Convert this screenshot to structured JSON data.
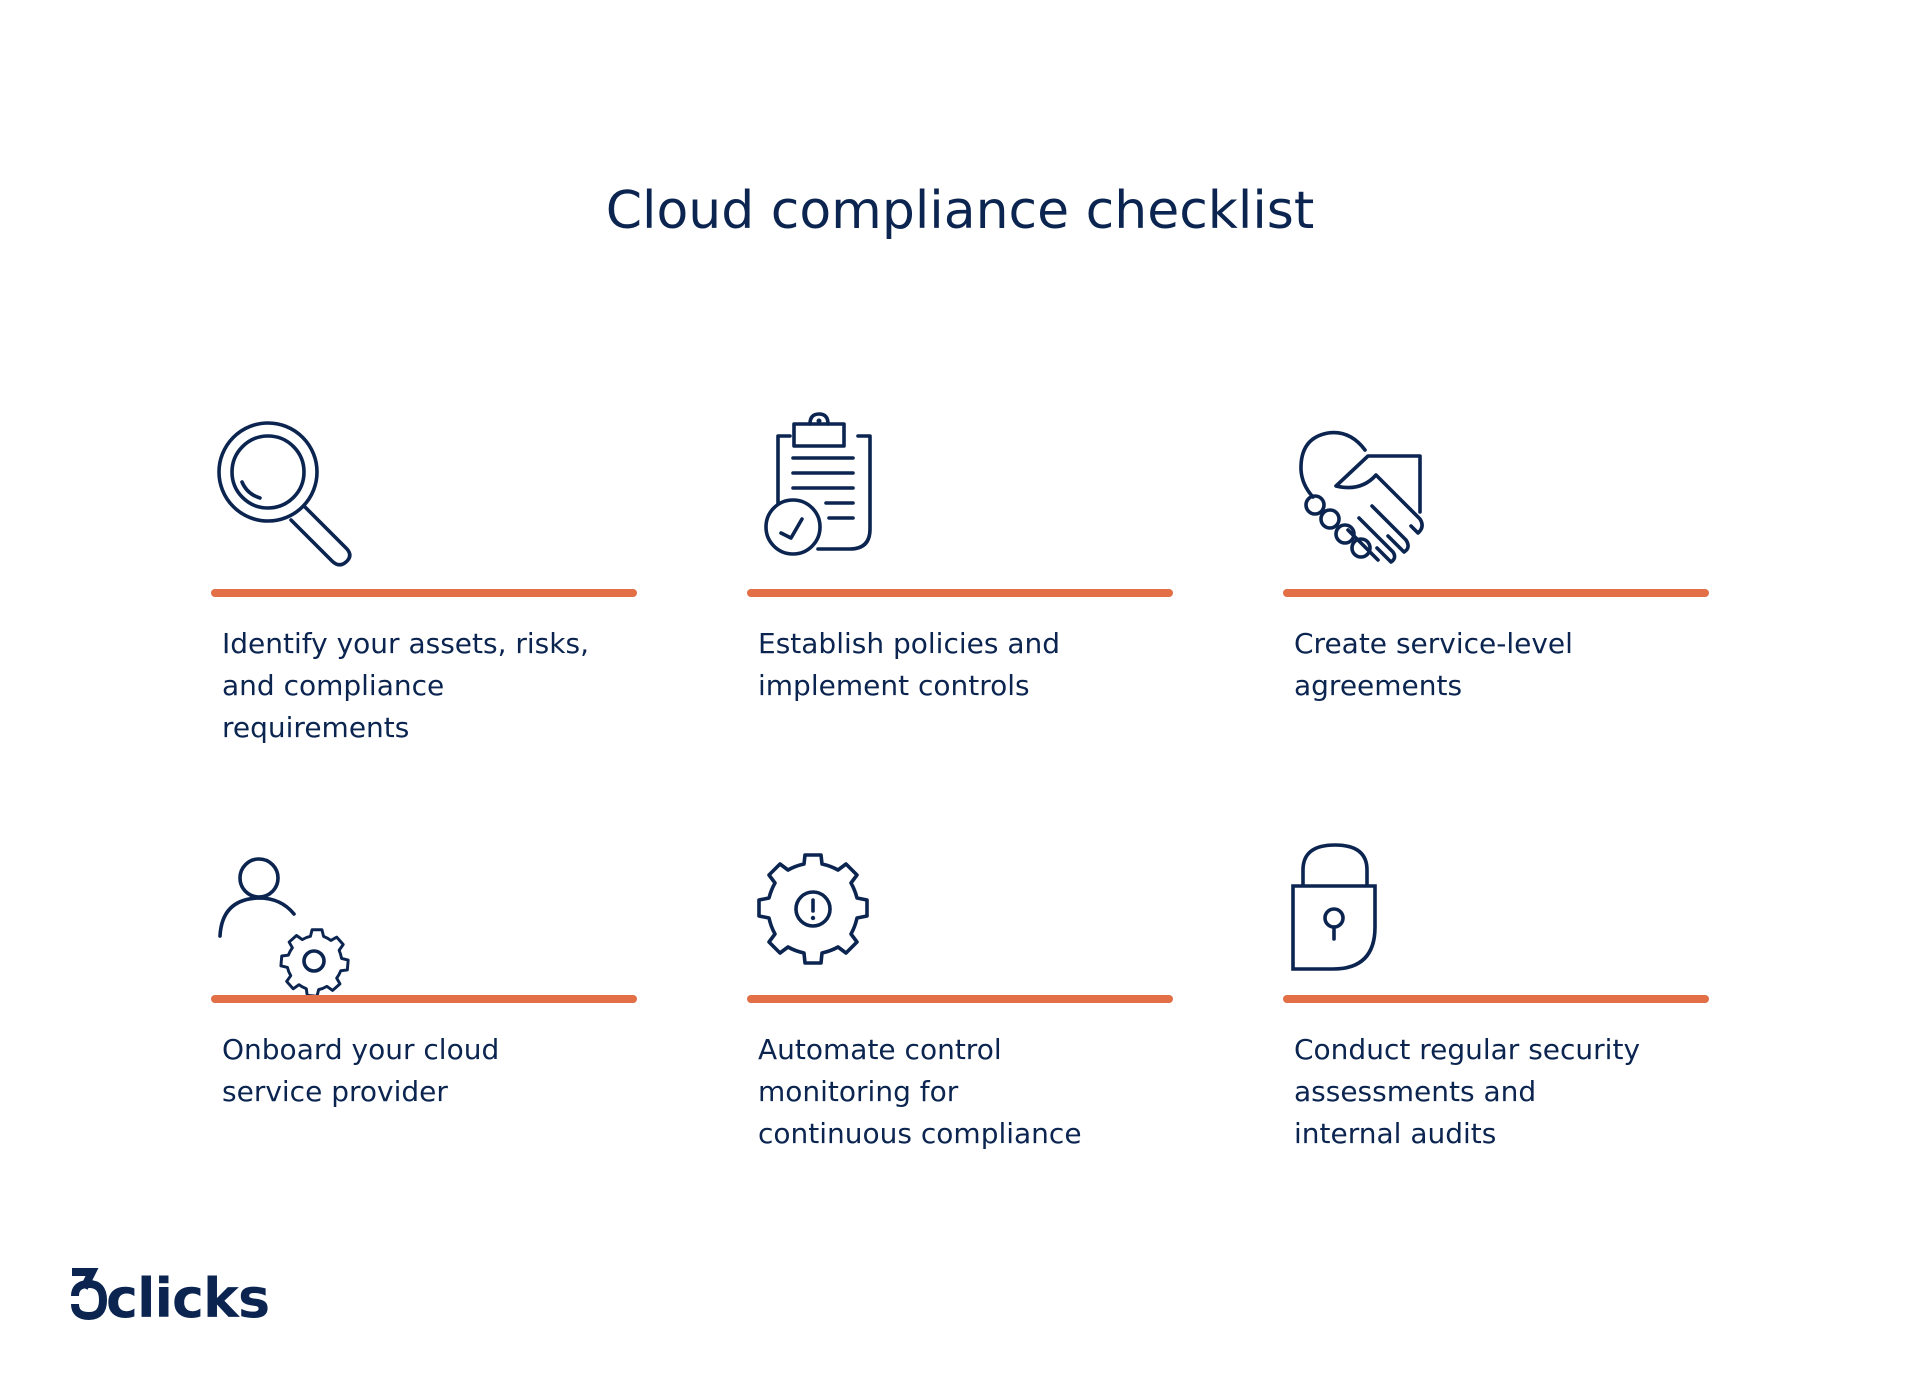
{
  "title": "Cloud compliance checklist",
  "colors": {
    "navy": "#0B2550",
    "accent_orange": "#E36F47",
    "background": "#FFFFFF"
  },
  "items": [
    {
      "icon": "magnifying-glass-icon",
      "text": "Identify your assets, risks, and compliance requirements",
      "lines": [
        "Identify your assets, risks,",
        "and compliance",
        "requirements"
      ]
    },
    {
      "icon": "clipboard-check-icon",
      "text": "Establish policies and implement controls",
      "lines": [
        "Establish policies and",
        "implement controls"
      ]
    },
    {
      "icon": "handshake-icon",
      "text": "Create service-level agreements",
      "lines": [
        "Create service-level",
        "agreements"
      ]
    },
    {
      "icon": "user-gear-icon",
      "text": "Onboard your cloud service provider",
      "lines": [
        "Onboard your cloud",
        "service provider"
      ]
    },
    {
      "icon": "gear-alert-icon",
      "text": "Automate control monitoring for continuous compliance",
      "lines": [
        "Automate control",
        "monitoring for",
        "continuous compliance"
      ]
    },
    {
      "icon": "padlock-icon",
      "text": "Conduct regular security assessments and internal audits",
      "lines": [
        "Conduct regular security",
        "assessments and",
        "internal audits"
      ]
    }
  ],
  "logo": {
    "text": "6clicks"
  }
}
